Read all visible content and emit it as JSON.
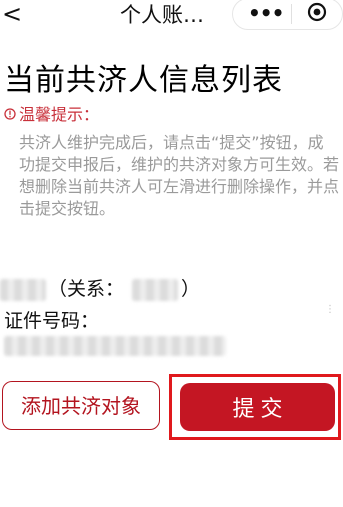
{
  "nav": {
    "back_glyph": "<",
    "title": "个人账…",
    "more_glyph": "•••",
    "back_icon": "chevron-left-icon",
    "more_icon": "more-dots-icon",
    "close_icon": "target-close-icon"
  },
  "page": {
    "title": "当前共济人信息列表"
  },
  "tip": {
    "icon": "alert-circle-icon",
    "title": "温馨提示：",
    "body": "共济人维护完成后，请点击“提交”按钮，成功提交申报后，维护的共济对象方可生效。若想删除当前共济人可左滑进行删除操作，并点击提交按钮。"
  },
  "record": {
    "relation_prefix": "（关系：",
    "relation_suffix": "）",
    "id_label": "证件号码：",
    "more_dots": "⋮"
  },
  "actions": {
    "add_label": "添加共济对象",
    "submit_label": "提交"
  },
  "colors": {
    "brand": "#c41623",
    "tip_title": "#c8303a",
    "tip_text": "#9a9a9a",
    "highlight_frame": "#e0191d"
  }
}
